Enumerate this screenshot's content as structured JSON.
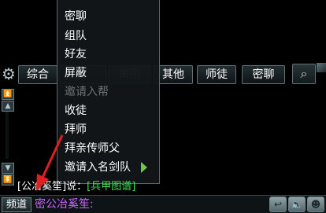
{
  "tabs": [
    "综合",
    "屏蔽",
    "常用",
    "其他",
    "师徒",
    "密聊"
  ],
  "menu": {
    "items": [
      {
        "label": "密聊",
        "enabled": true
      },
      {
        "label": "组队",
        "enabled": true
      },
      {
        "label": "好友",
        "enabled": true
      },
      {
        "label": "屏蔽",
        "enabled": true
      },
      {
        "label": "邀请入帮",
        "enabled": false
      },
      {
        "label": "收徒",
        "enabled": true
      },
      {
        "label": "拜师",
        "enabled": true
      },
      {
        "label": "拜亲传师父",
        "enabled": true
      },
      {
        "label": "邀请入名剑队",
        "enabled": true,
        "has_submenu": true
      }
    ]
  },
  "chat": {
    "speaker": "[公冶奚笙]说：",
    "link": "[兵甲图谱]"
  },
  "input": {
    "channel_label": "频道",
    "text": "密公冶奚笙:"
  },
  "colors": {
    "whisper": "#cc66ff",
    "item_link": "#3ee05a",
    "annotation_arrow": "#e02020"
  }
}
